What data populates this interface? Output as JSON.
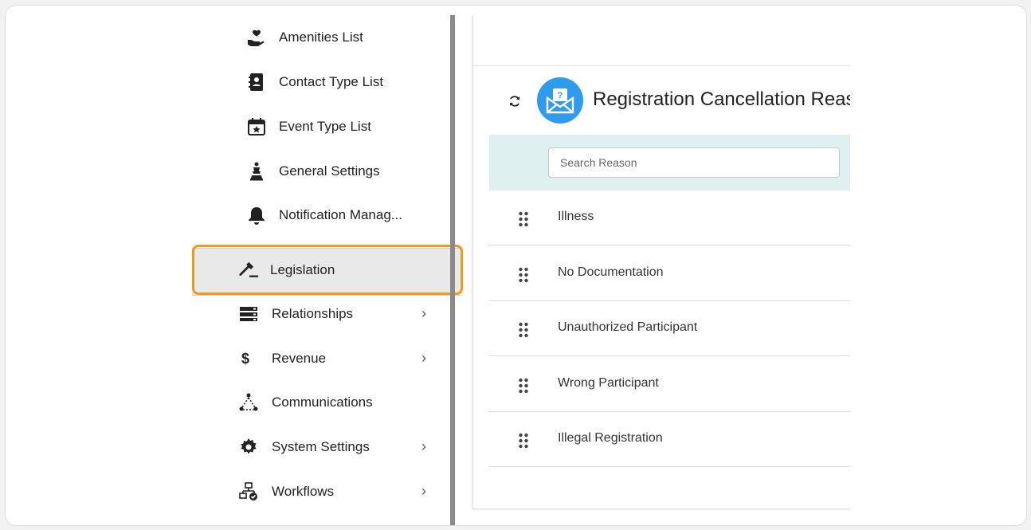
{
  "sidebar": {
    "items": [
      {
        "label": "Amenities List",
        "icon": "hand-heart-icon"
      },
      {
        "label": "Contact Type List",
        "icon": "contact-book-icon"
      },
      {
        "label": "Event Type List",
        "icon": "calendar-star-icon"
      },
      {
        "label": "General Settings",
        "icon": "chess-piece-icon"
      },
      {
        "label": "Notification Manag...",
        "icon": "bell-icon"
      },
      {
        "label": "Legislation",
        "icon": "gavel-icon"
      },
      {
        "label": "Relationships",
        "icon": "server-icon",
        "chevron": "›"
      },
      {
        "label": "Revenue",
        "icon": "dollar-icon",
        "chevron": "›"
      },
      {
        "label": "Communications",
        "icon": "network-icon"
      },
      {
        "label": "System Settings",
        "icon": "gear-icon",
        "chevron": "›"
      },
      {
        "label": "Workflows",
        "icon": "workflow-icon",
        "chevron": "›"
      }
    ],
    "dollar_glyph": "$"
  },
  "panel": {
    "title": "Registration Cancellation Reas",
    "search": {
      "placeholder": "Search Reason",
      "value": ""
    },
    "rows": [
      "Illness",
      "No Documentation",
      "Unauthorized Participant",
      "Wrong Participant",
      "Illegal Registration"
    ]
  },
  "colors": {
    "accent": "#2f9bec",
    "callout": "#f29a1c",
    "search_band": "#dff0f1"
  }
}
